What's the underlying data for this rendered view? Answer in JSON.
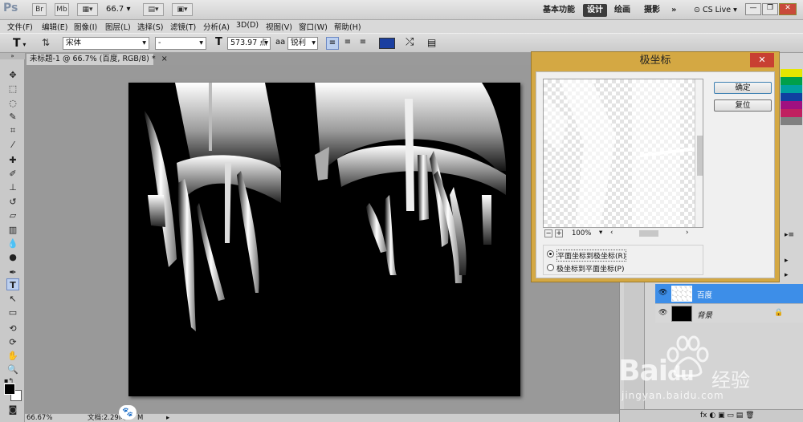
{
  "appbar": {
    "logo": "Ps",
    "br": "Br",
    "mb": "Mb",
    "zoom": "66.7",
    "workspaces": [
      "基本功能",
      "设计",
      "绘画",
      "摄影"
    ],
    "more": "»",
    "cslive": "CS Live"
  },
  "menu": [
    "文件(F)",
    "编辑(E)",
    "图像(I)",
    "图层(L)",
    "选择(S)",
    "滤镜(T)",
    "分析(A)",
    "3D(D)",
    "视图(V)",
    "窗口(W)",
    "帮助(H)"
  ],
  "options": {
    "tool_glyph": "T",
    "font_family": "宋体",
    "font_style": "-",
    "size_icon": "T",
    "font_size": "573.97 点",
    "aa_icon": "aa",
    "antialias": "锐利",
    "color": "#1b3fa0"
  },
  "document": {
    "tab_title": "未标题-1 @ 66.7% (百度, RGB/8) *",
    "zoom": "66.67%",
    "doc_info": "文档:2.29M/",
    "doc_info_tail": "M"
  },
  "dialog": {
    "title": "极坐标",
    "ok": "确定",
    "reset": "复位",
    "zoom": "100%",
    "options": [
      "平面坐标到极坐标(R)",
      "极坐标到平面坐标(P)"
    ],
    "selected": 0
  },
  "layers": [
    {
      "name": "百度",
      "selected": true
    },
    {
      "name": "背景",
      "selected": false
    }
  ],
  "watermark": {
    "brand": "Bai",
    "brand_tail": "经验",
    "url": "jingyan.baidu.com"
  }
}
